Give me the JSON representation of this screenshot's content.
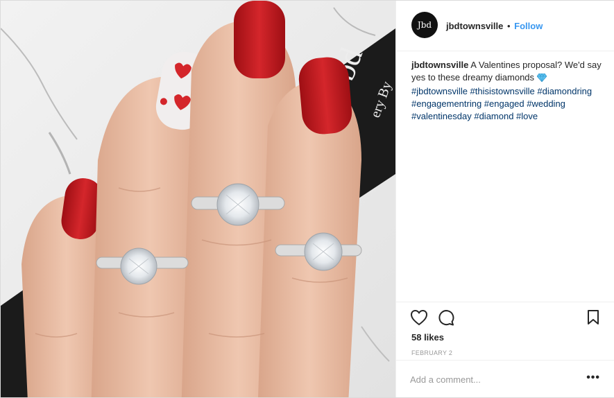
{
  "post": {
    "username": "jbdtownsville",
    "separator": "•",
    "follow_label": "Follow",
    "avatar_text": "Jbd",
    "caption": {
      "username": "jbdtownsville",
      "text": "A Valentines proposal? We'd say yes to these dreamy diamonds",
      "emoji_icon": "diamond-gem-icon",
      "hashtags": "#jbdtownsville #thisistownsville #diamondring #engagementring #engaged #wedding #valentinesday #diamond #love"
    },
    "likes": "58 likes",
    "date": "FEBRUARY 2",
    "comment_placeholder": "Add a comment...",
    "more_label": "•••",
    "photo": {
      "box_text": "Jbd",
      "box_subtext": "ery By"
    }
  },
  "colors": {
    "follow_blue": "#3897f0",
    "hashtag_blue": "#003569",
    "nail_red": "#c0161c",
    "skin": "#e8bfa7"
  }
}
